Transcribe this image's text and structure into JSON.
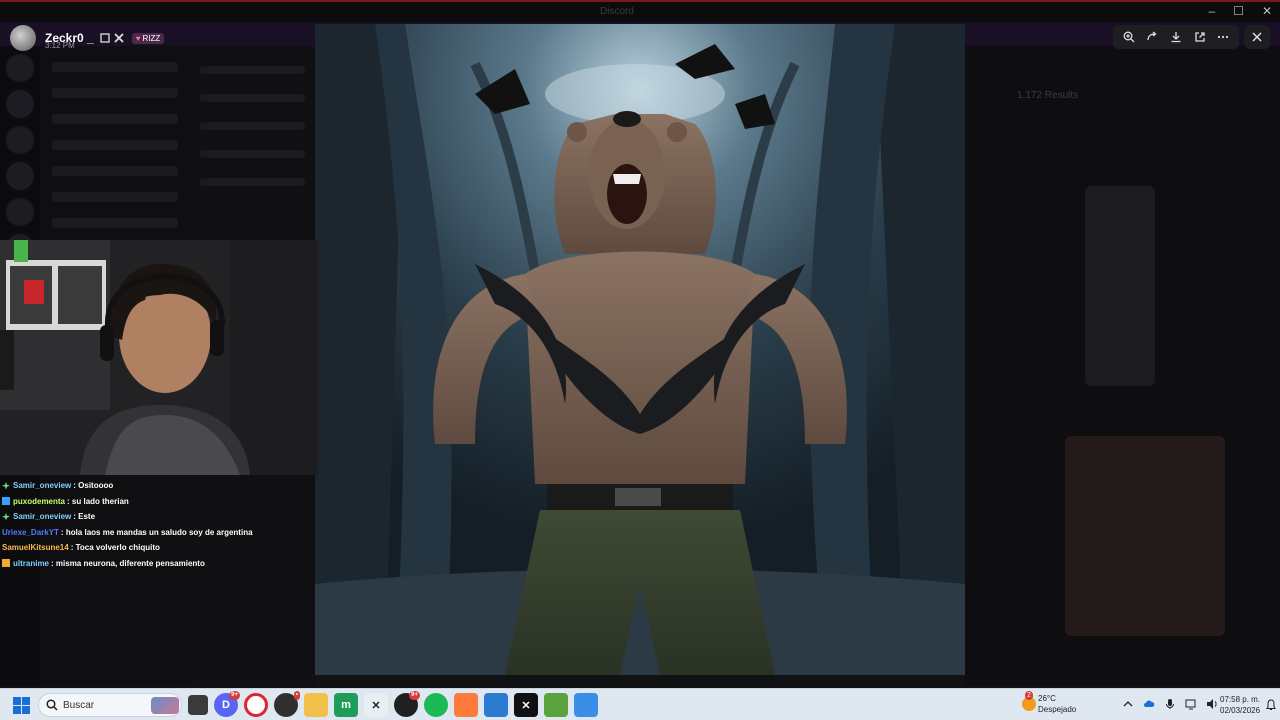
{
  "window": {
    "title": "Discord",
    "controls": [
      "minimize-icon",
      "maximize-icon",
      "close-icon"
    ]
  },
  "header": {
    "username": "Zeckr0 _",
    "time": "3:12 PM",
    "tag": "RIZZ"
  },
  "viewer_toolbar": {
    "buttons": [
      "zoom-in-icon",
      "rotate-icon",
      "download-icon",
      "open-external-icon",
      "more-icon"
    ],
    "close": "close-icon"
  },
  "image": {
    "subject": "bear-tearing-shirt-forest-artwork"
  },
  "background_right": {
    "results_text": "1,172 Results"
  },
  "chat": [
    {
      "user": "Samir_oneview",
      "message": "Ositoooo",
      "user_color": "#7fd0ff",
      "badge_color": "#6fdc6f"
    },
    {
      "user": "puxodementa",
      "message": "su lado therian",
      "user_color": "#c8ff6a",
      "badge_color": "#3aa0ff"
    },
    {
      "user": "Samir_oneview",
      "message": "Este",
      "user_color": "#7fd0ff",
      "badge_color": "#6fdc6f"
    },
    {
      "user": "Uriexe_DarkYT",
      "message": "hola laos me mandas un saludo soy de argentina",
      "user_color": "#4f7dff",
      "badge_color": ""
    },
    {
      "user": "SamuelKitsune14",
      "message": "Toca volverlo chiquito",
      "user_color": "#ffb84d",
      "badge_color": ""
    },
    {
      "user": "ultranime",
      "message": "misma neurona, diferente pensamiento",
      "user_color": "#7fd0ff",
      "badge_color": "#f2a93b"
    }
  ],
  "taskbar": {
    "search_placeholder": "Buscar",
    "apps": [
      {
        "name": "file-explorer-icon",
        "color": "#3a3a3a",
        "badge": ""
      },
      {
        "name": "discord-icon",
        "color": "#5865f2",
        "badge": "9+"
      },
      {
        "name": "opera-icon",
        "color": "#e0242c",
        "badge": ""
      },
      {
        "name": "chrome-icon",
        "color": "#2f2f2f",
        "badge": "•"
      },
      {
        "name": "folder-icon",
        "color": "#f2c14b",
        "badge": ""
      },
      {
        "name": "app-green-icon",
        "color": "#1e9c5a",
        "badge": ""
      },
      {
        "name": "capcut-icon",
        "color": "#e8eef2",
        "badge": ""
      },
      {
        "name": "obs-icon",
        "color": "#202020",
        "badge": "9+"
      },
      {
        "name": "spotify-icon",
        "color": "#1db954",
        "badge": ""
      },
      {
        "name": "soundcloud-icon",
        "color": "#ff7a3d",
        "badge": ""
      },
      {
        "name": "editor-icon",
        "color": "#2b7bd1",
        "badge": ""
      },
      {
        "name": "capcut-dark-icon",
        "color": "#111111",
        "badge": ""
      },
      {
        "name": "minecraft-icon",
        "color": "#5aa23d",
        "badge": ""
      },
      {
        "name": "photos-icon",
        "color": "#3a8ee6",
        "badge": ""
      }
    ],
    "weather": {
      "temp": "26°C",
      "condition": "Despejado",
      "alert": "2"
    },
    "clock": {
      "time": "07:58 p. m.",
      "date": "02/03/2026"
    }
  }
}
